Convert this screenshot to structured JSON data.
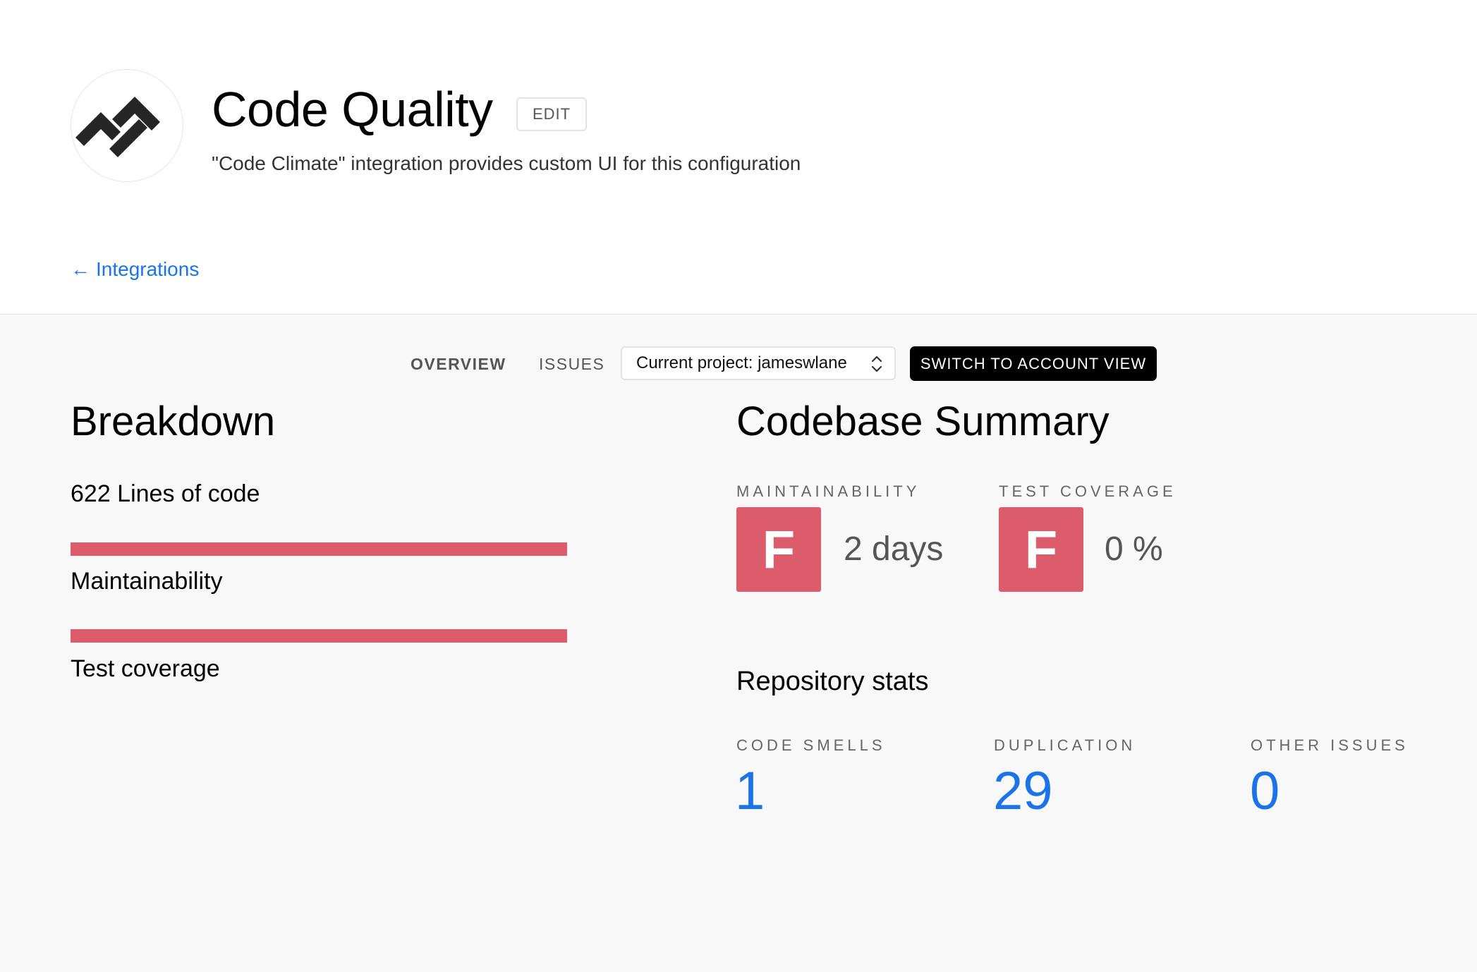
{
  "header": {
    "title": "Code Quality",
    "edit_label": "EDIT",
    "subtitle": "\"Code Climate\" integration provides custom UI for this configuration",
    "back_arrow": "←",
    "back_label": "Integrations",
    "logo_icon": "code-climate-logo-icon"
  },
  "toolbar": {
    "tabs": [
      {
        "label": "OVERVIEW",
        "active": true
      },
      {
        "label": "ISSUES",
        "active": false
      }
    ],
    "project_select": "Current project: jameswlane",
    "switch_button": "SWITCH TO ACCOUNT VIEW"
  },
  "breakdown": {
    "title": "Breakdown",
    "lines_of_code": "622 Lines of code",
    "bars": [
      {
        "label": "Maintainability",
        "fill": 1.0
      },
      {
        "label": "Test coverage",
        "fill": 1.0
      }
    ]
  },
  "summary": {
    "title": "Codebase Summary",
    "maintainability": {
      "label": "MAINTAINABILITY",
      "grade": "F",
      "value": "2 days"
    },
    "test_coverage": {
      "label": "TEST COVERAGE",
      "grade": "F",
      "value": "0 %"
    },
    "repo_stats_title": "Repository stats",
    "stats": [
      {
        "label": "CODE SMELLS",
        "value": "1"
      },
      {
        "label": "DUPLICATION",
        "value": "29"
      },
      {
        "label": "OTHER ISSUES",
        "value": "0"
      }
    ]
  },
  "colors": {
    "accent": "#1a73e8",
    "grade_f": "#dd5c6b",
    "button_dark": "#000000"
  }
}
